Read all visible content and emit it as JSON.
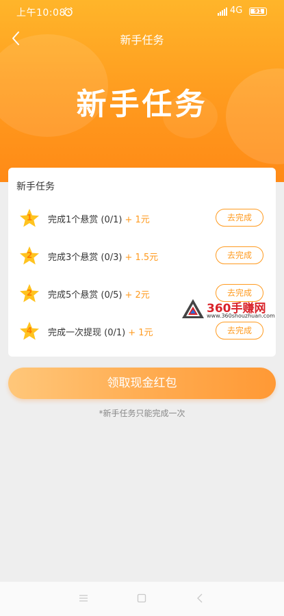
{
  "statusbar": {
    "time": "上午10:08",
    "network": "4G",
    "battery": "91"
  },
  "nav": {
    "title": "新手任务"
  },
  "hero": {
    "title": "新手任务"
  },
  "card": {
    "title": "新手任务",
    "tasks": [
      {
        "star": "1",
        "text": "完成1个悬赏 (0/1)",
        "reward": "+ 1元",
        "button": "去完成"
      },
      {
        "star": "2",
        "text": "完成3个悬赏 (0/3)",
        "reward": "+ 1.5元",
        "button": "去完成"
      },
      {
        "star": "2",
        "text": "完成5个悬赏 (0/5)",
        "reward": "+ 2元",
        "button": "去完成"
      },
      {
        "star": "4",
        "text": "完成一次提现 (0/1)",
        "reward": "+ 1元",
        "button": "去完成"
      }
    ]
  },
  "watermark": {
    "brand": "360手赚网",
    "url": "www.360shouzhuan.com"
  },
  "claim_button": "领取现金红包",
  "note": "*新手任务只能完成一次",
  "colors": {
    "accent": "#ff9a1e",
    "star": "#ffc31f"
  },
  "icons": {
    "back": "chevron-left-icon",
    "alarm": "alarm-clock-icon",
    "signal": "signal-icon",
    "battery": "battery-icon",
    "star": "star-icon",
    "nav_menu": "menu-icon",
    "nav_home": "home-square-icon",
    "nav_back": "back-triangle-icon"
  }
}
